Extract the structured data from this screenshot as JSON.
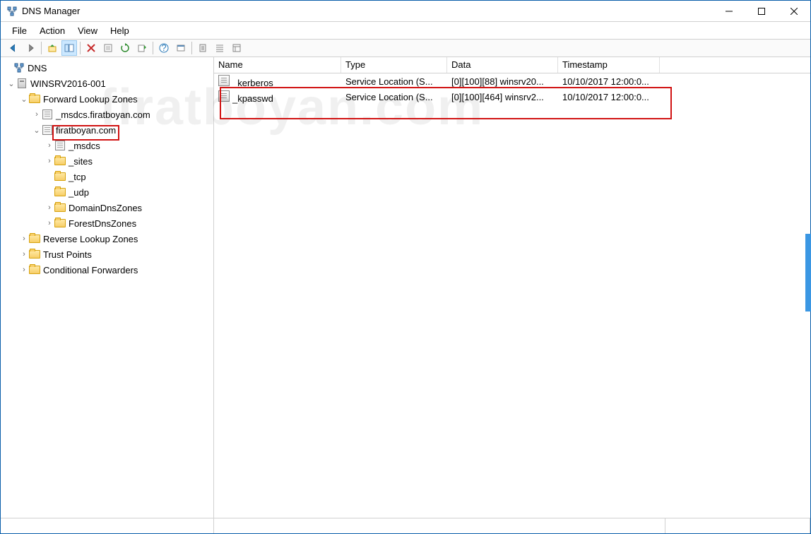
{
  "window": {
    "title": "DNS Manager"
  },
  "menu": {
    "file": "File",
    "action": "Action",
    "view": "View",
    "help": "Help"
  },
  "tree": {
    "root": "DNS",
    "server": "WINSRV2016-001",
    "flz": "Forward Lookup Zones",
    "msdcs_zone": "_msdcs.firatboyan.com",
    "main_zone": "firatboyan.com",
    "msdcs": "_msdcs",
    "sites": "_sites",
    "tcp": "_tcp",
    "udp": "_udp",
    "ddz": "DomainDnsZones",
    "fdz": "ForestDnsZones",
    "rlz": "Reverse Lookup Zones",
    "tp": "Trust Points",
    "cf": "Conditional Forwarders"
  },
  "columns": {
    "name": "Name",
    "type": "Type",
    "data": "Data",
    "timestamp": "Timestamp"
  },
  "colwidths": {
    "name": 180,
    "type": 150,
    "data": 157,
    "timestamp": 144
  },
  "rows": [
    {
      "name": "_kerberos",
      "type": "Service Location (S...",
      "data": "[0][100][88] winsrv20...",
      "timestamp": "10/10/2017 12:00:0..."
    },
    {
      "name": "_kpasswd",
      "type": "Service Location (S...",
      "data": "[0][100][464] winsrv2...",
      "timestamp": "10/10/2017 12:00:0..."
    }
  ],
  "watermark": "firatboyan.com"
}
